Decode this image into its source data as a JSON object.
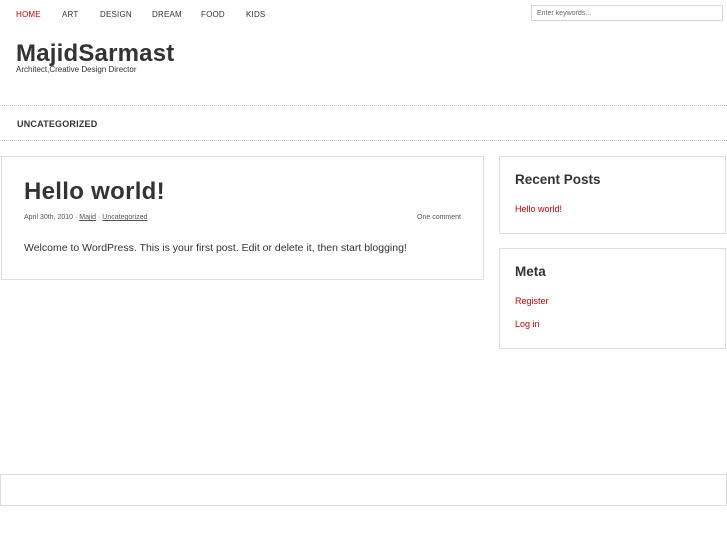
{
  "nav": {
    "items": [
      {
        "label": "HOME",
        "active": true
      },
      {
        "label": "ART",
        "active": false
      },
      {
        "label": "DESIGN",
        "active": false
      },
      {
        "label": "DREAM",
        "active": false
      },
      {
        "label": "FOOD",
        "active": false
      },
      {
        "label": "KIDS",
        "active": false
      }
    ]
  },
  "search": {
    "placeholder": "Enter keywords..."
  },
  "site": {
    "title": "MajidSarmast",
    "tagline": "Architect,Creative Design Director"
  },
  "category": {
    "label": "UNCATEGORIZED"
  },
  "post": {
    "title": "Hello world!",
    "date": "April 30th, 2010",
    "separator": "·",
    "author": "Majid",
    "category": "Uncategorized",
    "comments": "One comment",
    "body": "Welcome to WordPress. This is your first post. Edit or delete it, then start blogging!"
  },
  "sidebar": {
    "recent_posts": {
      "title": "Recent Posts",
      "links": [
        "Hello world!"
      ]
    },
    "meta": {
      "title": "Meta",
      "links": [
        "Register",
        "Log in"
      ]
    }
  },
  "colors": {
    "accent": "#cc0000",
    "text": "#333333",
    "border": "#dddddd"
  }
}
